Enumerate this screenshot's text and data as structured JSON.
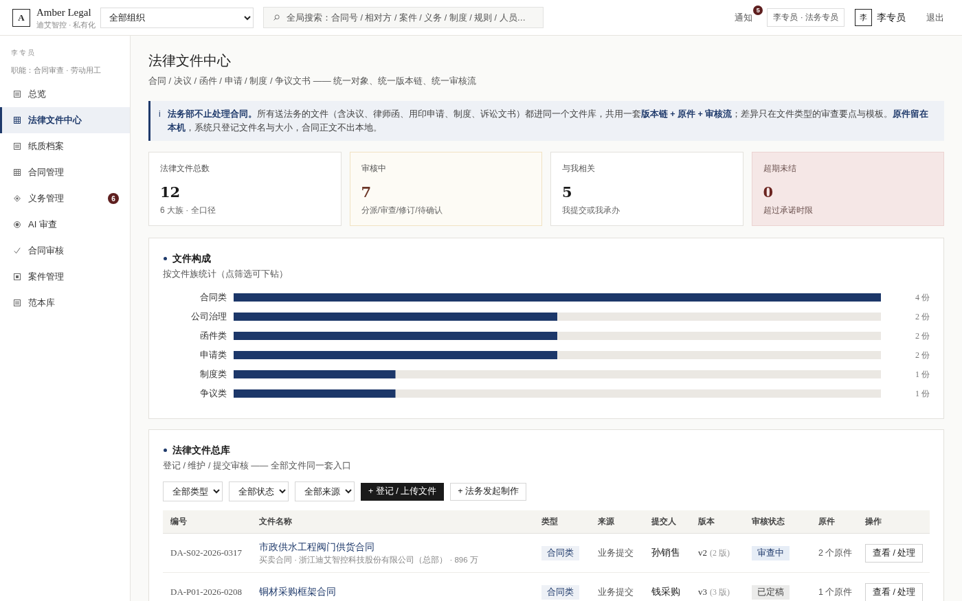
{
  "topbar": {
    "logo_mark": "A",
    "brand": "Amber Legal",
    "brand_sub": "迪艾智控 · 私有化",
    "org_select": "全部组织",
    "search": {
      "placeholder": "全局搜索：合同号 / 相对方 / 案件 / 义务 / 制度 / 规则 / 人员…"
    },
    "notifications": {
      "label": "通知",
      "count": "5"
    },
    "role": "李专员 · 法务专员",
    "avatar": "李",
    "user": "李专员",
    "logout": "退出"
  },
  "sidebar": {
    "user": "李专员",
    "duties": "职能：合同审查 · 劳动用工",
    "items": [
      {
        "label": "总览",
        "selected": false
      },
      {
        "label": "法律文件中心",
        "selected": true
      },
      {
        "label": "纸质档案",
        "selected": false
      },
      {
        "label": "合同管理",
        "selected": false
      },
      {
        "label": "义务管理",
        "selected": false,
        "badge": "6"
      },
      {
        "label": "AI 审查",
        "selected": false
      },
      {
        "label": "合同审核",
        "selected": false
      },
      {
        "label": "案件管理",
        "selected": false
      },
      {
        "label": "范本库",
        "selected": false
      }
    ]
  },
  "page": {
    "title": "法律文件中心",
    "subtitle": "合同 / 决议 / 函件 / 申请 / 制度 / 争议文书 —— 统一对象、统一版本链、统一审核流"
  },
  "notice": {
    "icon": "i",
    "text": "**法务部不止处理合同。**所有送法务的文件（含决议、律师函、用印申请、制度、诉讼文书）都进同一个文件库，共用一套**版本链 + 原件 + 审核流**；差异只在文件类型的审查要点与模板。**原件留在本机**，系统只登记文件名与大小，合同正文不出本地。"
  },
  "stats": [
    {
      "label": "法律文件总数",
      "value": "12",
      "note": "6 大族 · 全口径",
      "kind": "plain"
    },
    {
      "label": "审核中",
      "value": "7",
      "note": "分派/审查/修订/待确认",
      "kind": "pending"
    },
    {
      "label": "与我相关",
      "value": "5",
      "note": "我提交或我承办",
      "kind": "plain"
    },
    {
      "label": "超期未结",
      "value": "0",
      "note": "超过承诺时限",
      "kind": "overdue"
    }
  ],
  "composition": {
    "title": "文件构成",
    "subtitle": "按文件族统计（点筛选可下钻）",
    "chart_data": {
      "type": "bar",
      "orientation": "horizontal",
      "categories": [
        "合同类",
        "公司治理",
        "函件类",
        "申请类",
        "制度类",
        "争议类"
      ],
      "values": [
        4,
        2,
        2,
        2,
        1,
        1
      ],
      "value_labels": [
        "4 份",
        "2 份",
        "2 份",
        "2 份",
        "1 份",
        "1 份"
      ]
    }
  },
  "library": {
    "title": "法律文件总库",
    "subtitle": "登记 / 维护 / 提交审核 —— 全部文件同一套入口",
    "filters": [
      "全部类型",
      "全部状态",
      "全部来源"
    ],
    "buttons": [
      {
        "label": "+ 登记 / 上传文件",
        "kind": "primary"
      },
      {
        "label": "+ 法务发起制作",
        "kind": "secondary"
      }
    ],
    "table": {
      "columns": [
        "编号",
        "文件名称",
        "类型",
        "来源",
        "提交人",
        "版本",
        "审核状态",
        "原件",
        "操作"
      ],
      "rows": [
        {
          "code": "DA-S02-2026-0317",
          "title": "市政供水工程阀门供货合同",
          "meta": "买卖合同 · 浙江迪艾智控科技股份有限公司（总部） · 896 万",
          "type": "合同类",
          "source": "业务提交",
          "submitter": "孙销售",
          "version": "v2",
          "versions": "(2 版)",
          "status": {
            "text": "审查中",
            "kind": "reviewing"
          },
          "originals": "2 个原件",
          "action": "查看 / 处理"
        },
        {
          "code": "DA-P01-2026-0208",
          "title": "铜材采购框架合同",
          "type": "合同类",
          "source": "业务提交",
          "submitter": "钱采购",
          "version": "v3",
          "versions": "(3 版)",
          "status": {
            "text": "已定稿",
            "kind": "final"
          },
          "originals": "1 个原件",
          "action": "查看 / 处理"
        }
      ]
    }
  }
}
